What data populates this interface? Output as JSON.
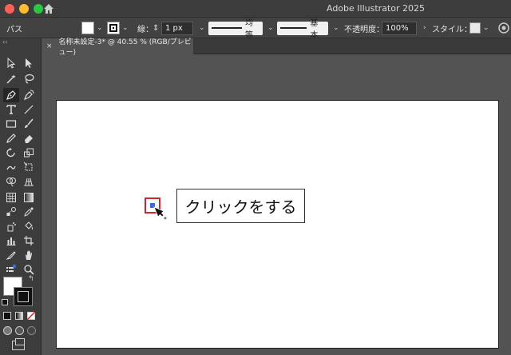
{
  "window": {
    "title": "Adobe Illustrator 2025"
  },
  "controlbar": {
    "object_type": "パス",
    "stroke_label": "線：",
    "stroke_weight": "1 px",
    "profile_label": "均等",
    "brush_label": "基本",
    "opacity_label": "不透明度：",
    "opacity_value": "100%",
    "style_label": "スタイル："
  },
  "document": {
    "tab_title": "名称未設定-3* @ 40.55 % (RGB/プレビュー)",
    "close_glyph": "×"
  },
  "canvas": {
    "callout_text": "クリックをする"
  },
  "icons": {
    "home": "home-icon",
    "pen_cursor": "pen-cursor-icon"
  },
  "colors": {
    "highlight": "#d0262b",
    "anchor": "#3b6bd9"
  }
}
